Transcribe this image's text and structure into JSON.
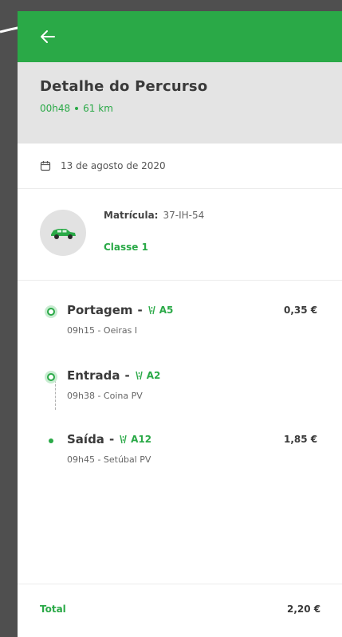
{
  "header": {
    "title": "Detalhe do Percurso",
    "duration": "00h48",
    "distance": "61 km"
  },
  "date": "13 de agosto de 2020",
  "vehicle": {
    "plate_label": "Matrícula:",
    "plate": "37-IH-54",
    "class": "Classe 1"
  },
  "stops": [
    {
      "name": "Portagem",
      "road": "A5",
      "time_place": "09h15 - Oeiras I",
      "price": "0,35 €"
    },
    {
      "name": "Entrada",
      "road": "A2",
      "time_place": "09h38 - Coina PV",
      "price": ""
    },
    {
      "name": "Saída",
      "road": "A12",
      "time_place": "09h45 - Setúbal PV",
      "price": "1,85 €"
    }
  ],
  "total": {
    "label": "Total",
    "value": "2,20 €"
  },
  "colors": {
    "accent": "#2aa947",
    "header_bg": "#e4e4e4",
    "backdrop": "#4f4f4f"
  },
  "icons": {
    "back": "arrow-left-icon",
    "date": "calendar-icon",
    "vehicle": "car-icon",
    "road": "highway-icon"
  }
}
